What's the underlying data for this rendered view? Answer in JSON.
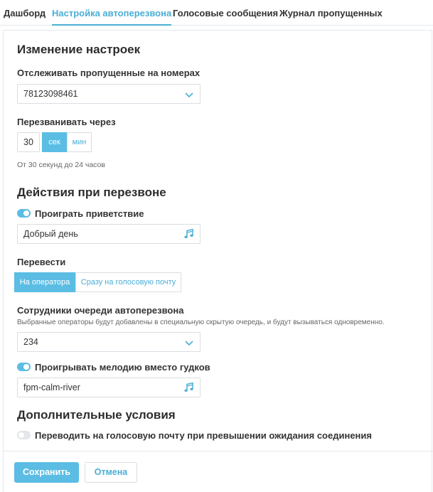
{
  "tabs": [
    {
      "label": "Дашборд",
      "active": false
    },
    {
      "label": "Настройка автоперезвона",
      "active": true
    },
    {
      "label": "Голосовые сообщения",
      "active": false
    },
    {
      "label": "Журнал пропущенных",
      "active": false
    }
  ],
  "settings": {
    "title": "Изменение настроек",
    "track_label": "Отслеживать пропущенные на номерах",
    "track_value": "78123098461",
    "callback_label": "Перезванивать через",
    "callback_value": "30",
    "unit_sec": "сек",
    "unit_min": "мин",
    "unit_selected": "сек",
    "callback_hint": "От 30 секунд до 24 часов"
  },
  "actions": {
    "title": "Действия при перезвоне",
    "greeting_toggle_label": "Проиграть приветствие",
    "greeting_toggle_on": true,
    "greeting_value": "Добрый день",
    "transfer_label": "Перевести",
    "transfer_operator": "На оператора",
    "transfer_voicemail": "Сразу на голосовую почту",
    "transfer_selected": "На оператора",
    "queue_label": "Сотрудники очереди автоперезвона",
    "queue_hint": "Выбранные операторы будут добавлены в специальную скрытую очередь, и будут вызываться одновременно.",
    "queue_value": "234",
    "melody_toggle_label": "Проигрывать мелодию вместо гудков",
    "melody_toggle_on": true,
    "melody_value": "fpm-calm-river"
  },
  "extra": {
    "title": "Дополнительные условия",
    "voicemail_toggle_label": "Переводить на голосовую почту при превышении ожидания соединения",
    "voicemail_toggle_on": false
  },
  "footer": {
    "save_label": "Сохранить",
    "cancel_label": "Отмена"
  },
  "colors": {
    "accent": "#5bbde3",
    "accent_text": "#4aaed6",
    "border": "#d9dde2"
  },
  "icons": {
    "select_chevron": "chevron-down-icon",
    "audio": "music-note-icon"
  }
}
